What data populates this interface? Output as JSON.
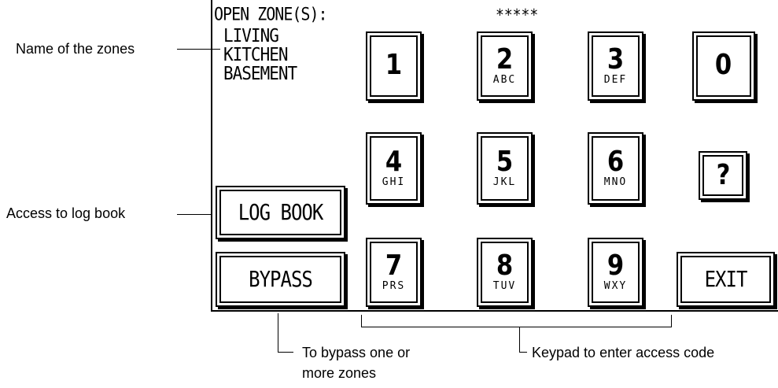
{
  "header": {
    "title": "OPEN ZONE(S):",
    "code": "*****"
  },
  "zones": [
    "LIVING",
    "KITCHEN",
    "BASEMENT"
  ],
  "keypad": [
    {
      "digit": "1",
      "letters": ""
    },
    {
      "digit": "2",
      "letters": "ABC"
    },
    {
      "digit": "3",
      "letters": "DEF"
    },
    {
      "digit": "0",
      "letters": ""
    },
    {
      "digit": "4",
      "letters": "GHI"
    },
    {
      "digit": "5",
      "letters": "JKL"
    },
    {
      "digit": "6",
      "letters": "MNO"
    },
    {
      "digit": "?",
      "letters": ""
    },
    {
      "digit": "7",
      "letters": "PRS"
    },
    {
      "digit": "8",
      "letters": "TUV"
    },
    {
      "digit": "9",
      "letters": "WXY"
    }
  ],
  "buttons": {
    "log_book": "LOG BOOK",
    "bypass": "BYPASS",
    "exit": "EXIT"
  },
  "callouts": {
    "zone_names": "Name of the zones",
    "log_book": "Access to log book",
    "bypass_line1": "To bypass one or",
    "bypass_line2": "more zones",
    "keypad": "Keypad to enter access code"
  }
}
